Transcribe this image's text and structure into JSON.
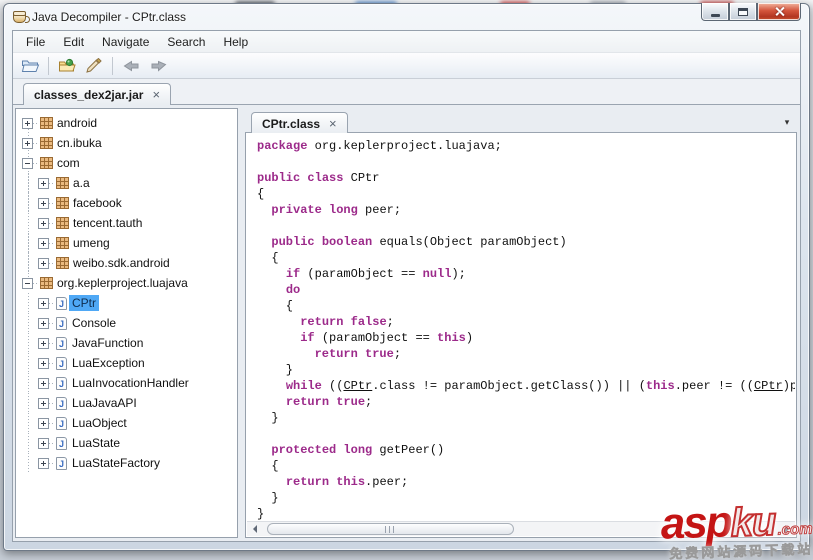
{
  "window": {
    "title": "Java Decompiler - CPtr.class"
  },
  "menu": {
    "items": [
      "File",
      "Edit",
      "Navigate",
      "Search",
      "Help"
    ]
  },
  "toolbar": {
    "buttons": [
      "open-file",
      "separator",
      "open-type",
      "paintbrush",
      "separator",
      "back",
      "forward"
    ]
  },
  "tabs": {
    "main": {
      "label": "classes_dex2jar.jar",
      "close": "×"
    },
    "code": {
      "label": "CPtr.class",
      "close": "×"
    }
  },
  "icons": {
    "tab_overflow": "▾",
    "class_letter": "J"
  },
  "tree": {
    "items": [
      {
        "expand": "plus",
        "icon": "package",
        "label": "android",
        "depth": 0,
        "selected": false
      },
      {
        "expand": "plus",
        "icon": "package",
        "label": "cn.ibuka",
        "depth": 0,
        "selected": false
      },
      {
        "expand": "minus",
        "icon": "package",
        "label": "com",
        "depth": 0,
        "selected": false
      },
      {
        "expand": "plus",
        "icon": "package",
        "label": "a.a",
        "depth": 1,
        "selected": false
      },
      {
        "expand": "plus",
        "icon": "package",
        "label": "facebook",
        "depth": 1,
        "selected": false
      },
      {
        "expand": "plus",
        "icon": "package",
        "label": "tencent.tauth",
        "depth": 1,
        "selected": false
      },
      {
        "expand": "plus",
        "icon": "package",
        "label": "umeng",
        "depth": 1,
        "selected": false
      },
      {
        "expand": "plus",
        "icon": "package",
        "label": "weibo.sdk.android",
        "depth": 1,
        "selected": false
      },
      {
        "expand": "minus",
        "icon": "package",
        "label": "org.keplerproject.luajava",
        "depth": 0,
        "selected": false
      },
      {
        "expand": "plus",
        "icon": "class",
        "label": "CPtr",
        "depth": 1,
        "selected": true
      },
      {
        "expand": "plus",
        "icon": "class",
        "label": "Console",
        "depth": 1,
        "selected": false
      },
      {
        "expand": "plus",
        "icon": "class",
        "label": "JavaFunction",
        "depth": 1,
        "selected": false
      },
      {
        "expand": "plus",
        "icon": "class",
        "label": "LuaException",
        "depth": 1,
        "selected": false
      },
      {
        "expand": "plus",
        "icon": "class",
        "label": "LuaInvocationHandler",
        "depth": 1,
        "selected": false
      },
      {
        "expand": "plus",
        "icon": "class",
        "label": "LuaJavaAPI",
        "depth": 1,
        "selected": false
      },
      {
        "expand": "plus",
        "icon": "class",
        "label": "LuaObject",
        "depth": 1,
        "selected": false
      },
      {
        "expand": "plus",
        "icon": "class",
        "label": "LuaState",
        "depth": 1,
        "selected": false
      },
      {
        "expand": "plus",
        "icon": "class",
        "label": "LuaStateFactory",
        "depth": 1,
        "selected": false
      }
    ]
  },
  "code": {
    "lines": [
      [
        [
          "k",
          "package"
        ],
        [
          "p",
          " org.keplerproject.luajava;"
        ]
      ],
      [],
      [
        [
          "k",
          "public"
        ],
        [
          "p",
          " "
        ],
        [
          "k",
          "class"
        ],
        [
          "p",
          " CPtr"
        ]
      ],
      [
        [
          "p",
          "{"
        ]
      ],
      [
        [
          "p",
          "  "
        ],
        [
          "k",
          "private"
        ],
        [
          "p",
          " "
        ],
        [
          "k",
          "long"
        ],
        [
          "p",
          " peer;"
        ]
      ],
      [],
      [
        [
          "p",
          "  "
        ],
        [
          "k",
          "public"
        ],
        [
          "p",
          " "
        ],
        [
          "k",
          "boolean"
        ],
        [
          "p",
          " equals(Object paramObject)"
        ]
      ],
      [
        [
          "p",
          "  {"
        ]
      ],
      [
        [
          "p",
          "    "
        ],
        [
          "k",
          "if"
        ],
        [
          "p",
          " (paramObject == "
        ],
        [
          "k",
          "null"
        ],
        [
          "p",
          ");"
        ]
      ],
      [
        [
          "p",
          "    "
        ],
        [
          "k",
          "do"
        ]
      ],
      [
        [
          "p",
          "    {"
        ]
      ],
      [
        [
          "p",
          "      "
        ],
        [
          "k",
          "return"
        ],
        [
          "p",
          " "
        ],
        [
          "k",
          "false"
        ],
        [
          "p",
          ";"
        ]
      ],
      [
        [
          "p",
          "      "
        ],
        [
          "k",
          "if"
        ],
        [
          "p",
          " (paramObject == "
        ],
        [
          "k",
          "this"
        ],
        [
          "p",
          ")"
        ]
      ],
      [
        [
          "p",
          "        "
        ],
        [
          "k",
          "return"
        ],
        [
          "p",
          " "
        ],
        [
          "k",
          "true"
        ],
        [
          "p",
          ";"
        ]
      ],
      [
        [
          "p",
          "    }"
        ]
      ],
      [
        [
          "p",
          "    "
        ],
        [
          "k",
          "while"
        ],
        [
          "p",
          " (("
        ],
        [
          "u",
          "CPtr"
        ],
        [
          "p",
          ".class != paramObject.getClass()) || ("
        ],
        [
          "k",
          "this"
        ],
        [
          "p",
          ".peer != (("
        ],
        [
          "u",
          "CPtr"
        ],
        [
          "p",
          ")para"
        ]
      ],
      [
        [
          "p",
          "    "
        ],
        [
          "k",
          "return"
        ],
        [
          "p",
          " "
        ],
        [
          "k",
          "true"
        ],
        [
          "p",
          ";"
        ]
      ],
      [
        [
          "p",
          "  }"
        ]
      ],
      [],
      [
        [
          "p",
          "  "
        ],
        [
          "k",
          "protected"
        ],
        [
          "p",
          " "
        ],
        [
          "k",
          "long"
        ],
        [
          "p",
          " getPeer()"
        ]
      ],
      [
        [
          "p",
          "  {"
        ]
      ],
      [
        [
          "p",
          "    "
        ],
        [
          "k",
          "return"
        ],
        [
          "p",
          " "
        ],
        [
          "k",
          "this"
        ],
        [
          "p",
          ".peer;"
        ]
      ],
      [
        [
          "p",
          "  }"
        ]
      ],
      [
        [
          "p",
          "}"
        ]
      ]
    ]
  },
  "watermark": {
    "brand_bold": "asp",
    "brand_outline": "ku",
    "tld": ".com",
    "tagline": "免费网站源码下载站"
  },
  "colors": {
    "keyword": "#9c2a8a",
    "selection": "#4fa8f5",
    "close_button": "#c8502f"
  }
}
